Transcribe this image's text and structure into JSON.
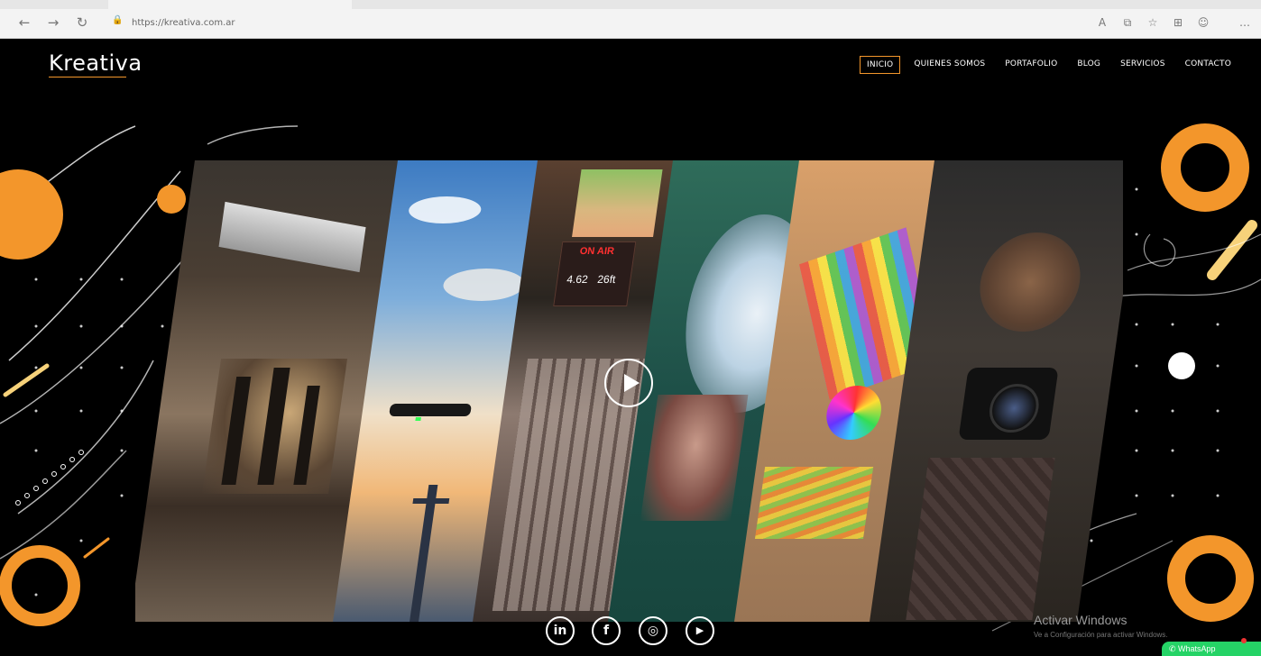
{
  "browser": {
    "url": "https://kreativa.com.ar",
    "back_icon": "arrow-left-icon",
    "forward_icon": "arrow-right-icon",
    "refresh_icon": "refresh-icon",
    "toolbar_icons": [
      "read-aloud-icon",
      "tab-icon",
      "favorites-icon",
      "collections-icon",
      "profile-icon",
      "more-icon"
    ]
  },
  "site": {
    "logo": "Kreativa",
    "nav": [
      {
        "label": "INICIO",
        "active": true
      },
      {
        "label": "QUIENES SOMOS",
        "active": false
      },
      {
        "label": "PORTAFOLIO",
        "active": false
      },
      {
        "label": "BLOG",
        "active": false
      },
      {
        "label": "SERVICIOS",
        "active": false
      },
      {
        "label": "CONTACTO",
        "active": false
      }
    ]
  },
  "hero": {
    "panels": [
      "film-set",
      "drone-sky",
      "broadcast-studio",
      "fisheye-water",
      "color-palette",
      "photographer"
    ],
    "studio_sign": "ON AIR",
    "studio_values": [
      "4.62",
      "26ft"
    ],
    "play_icon": "play-icon"
  },
  "social": [
    {
      "name": "linkedin-icon",
      "glyph": "in"
    },
    {
      "name": "facebook-icon",
      "glyph": "f"
    },
    {
      "name": "instagram-icon",
      "glyph": "◎"
    },
    {
      "name": "youtube-icon",
      "glyph": "▶"
    }
  ],
  "windows": {
    "title": "Activar Windows",
    "subtitle": "Ve a Configuración para activar Windows."
  },
  "whatsapp": {
    "label": "WhatsApp"
  },
  "colors": {
    "accent": "#f3962b",
    "light_accent": "#f7d27a",
    "background": "#000000"
  }
}
